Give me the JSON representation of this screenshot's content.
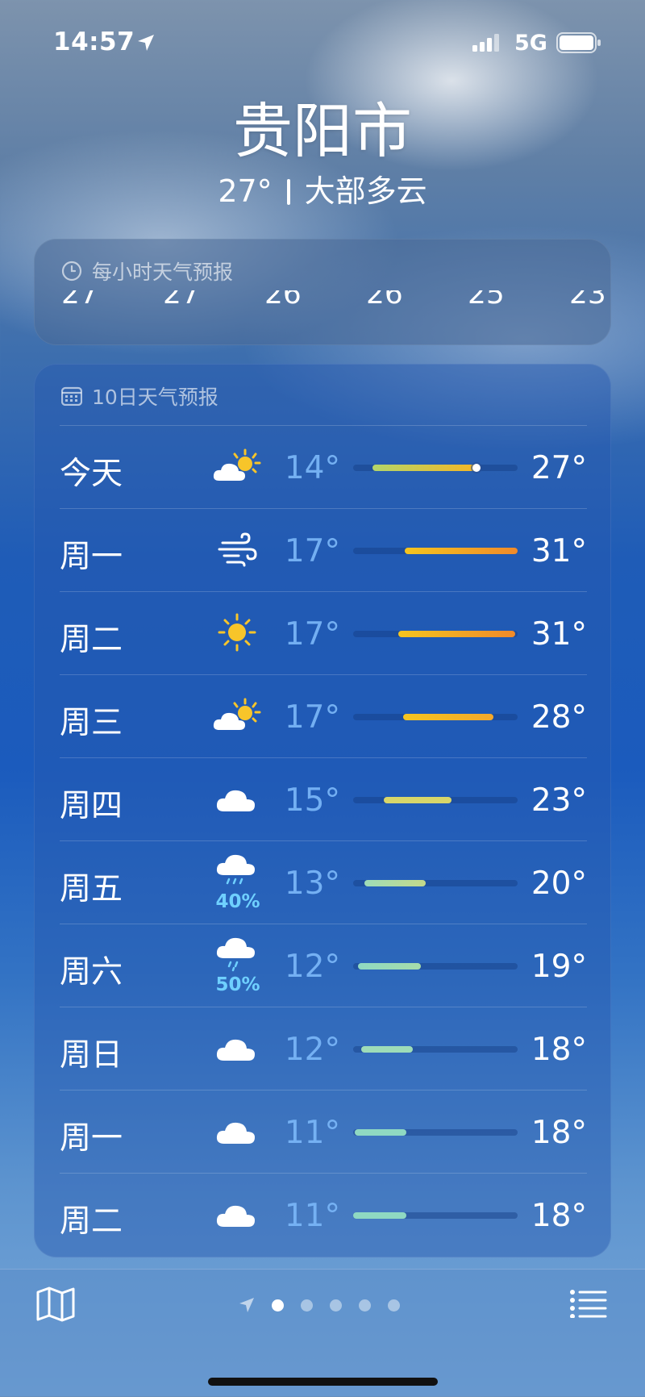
{
  "status": {
    "time": "14:57",
    "network": "5G"
  },
  "header": {
    "city": "贵阳市",
    "temp": "27°",
    "condition": "大部多云"
  },
  "hourly": {
    "title": "每小时天气预报",
    "temps": [
      "27",
      "27",
      "26",
      "26",
      "25",
      "23"
    ]
  },
  "daily": {
    "title": "10日天气预报",
    "rows": [
      {
        "day": "今天",
        "icon": "partly-sunny-icon",
        "low": "14°",
        "high": "27°",
        "precip": ""
      },
      {
        "day": "周一",
        "icon": "wind-icon",
        "low": "17°",
        "high": "31°",
        "precip": ""
      },
      {
        "day": "周二",
        "icon": "sun-icon",
        "low": "17°",
        "high": "31°",
        "precip": ""
      },
      {
        "day": "周三",
        "icon": "partly-sunny-icon",
        "low": "17°",
        "high": "28°",
        "precip": ""
      },
      {
        "day": "周四",
        "icon": "cloud-icon",
        "low": "15°",
        "high": "23°",
        "precip": ""
      },
      {
        "day": "周五",
        "icon": "rain-icon",
        "low": "13°",
        "high": "20°",
        "precip": "40%"
      },
      {
        "day": "周六",
        "icon": "rain-icon",
        "low": "12°",
        "high": "19°",
        "precip": "50%"
      },
      {
        "day": "周日",
        "icon": "cloud-icon",
        "low": "12°",
        "high": "18°",
        "precip": ""
      },
      {
        "day": "周一",
        "icon": "cloud-icon",
        "low": "11°",
        "high": "18°",
        "precip": ""
      },
      {
        "day": "周二",
        "icon": "cloud-icon",
        "low": "11°",
        "high": "18°",
        "precip": ""
      }
    ]
  },
  "colors": {
    "accent_warm": "#f5b624",
    "accent_hot": "#f08a2a",
    "accent_cool": "#8fd9c2",
    "mild": "#d8d66a"
  }
}
